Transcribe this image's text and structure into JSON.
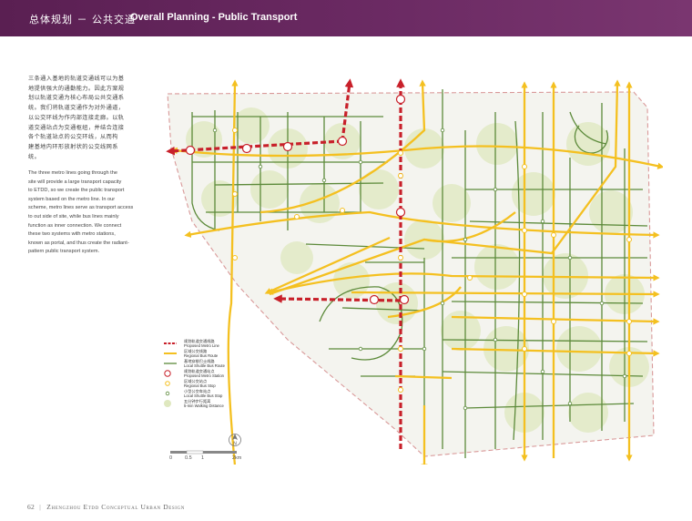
{
  "header": {
    "title_cn": "总体规划 － 公共交通",
    "title_en": "Overall Planning - Public Transport"
  },
  "text": {
    "cn_lines": [
      "三条通入基地的轨道交通线可以为基",
      "地提供强大的通勤能力。因此方案规",
      "划以轨道交通为核心布局公共交通系",
      "统。我们将轨道交通作为对外通道，",
      "以公交环线为作内部连接走廊。以轨",
      "道交通站点为交通枢纽，并结合连接",
      "各个轨道站点的公交环线，从而构",
      "建基地内环形放射状的公交线网系",
      "统。"
    ],
    "en_lines": [
      "The three metro lines going through the",
      "site will provide a large transport capacity",
      "to ETDD, so we create the public transport",
      "system based on the metro line. In our",
      "scheme, metro lines serve as transport access",
      "to out side of site, while bus lines mainly",
      "function as inner connection. We connect",
      "these two systems with metro stations,",
      "known as portal, and thus create the radiant-",
      "pattern public transport system."
    ]
  },
  "legend": [
    {
      "symbol": "metro-line",
      "cn": "规划轨道交通线路",
      "en": "Proposed Metro Line"
    },
    {
      "symbol": "regional-bus",
      "cn": "区域公交线路",
      "en": "Regional Bus Route"
    },
    {
      "symbol": "local-bus",
      "cn": "基地穿梭巴士线路",
      "en": "Local Shuttle Bus Route"
    },
    {
      "symbol": "metro-station",
      "cn": "规划轨道交通站点",
      "en": "Proposed Metro Station"
    },
    {
      "symbol": "regional-stop",
      "cn": "区域公交站点",
      "en": "Regional Bus Stop"
    },
    {
      "symbol": "local-stop",
      "cn": "小型公交车站点",
      "en": "Local Shuttle Bus Stop"
    },
    {
      "symbol": "walking",
      "cn": "五分钟步行距离",
      "en": "5-min Walking Distance"
    }
  ],
  "scale": {
    "labels": [
      "0",
      "0.5",
      "1",
      "2km"
    ]
  },
  "north": {
    "label": "N"
  },
  "footer": {
    "page_number": "62",
    "separator": "|",
    "title": "Zhengzhou Etdd Conceptual Urban Design"
  },
  "colors": {
    "header_bg": "#5e2357",
    "metro": "#c8202a",
    "regional_bus": "#f4c020",
    "local_bus": "#5c8a3a",
    "walk_zone": "#dfe8bf",
    "boundary": "#d99999"
  }
}
